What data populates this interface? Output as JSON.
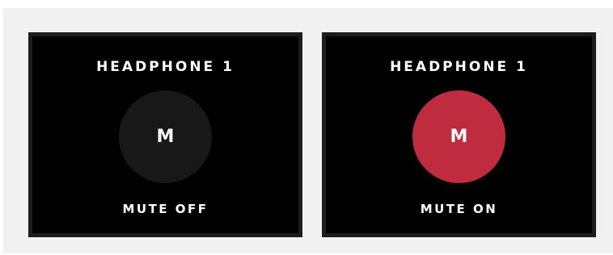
{
  "colors": {
    "panel_background": "#000000",
    "panel_border": "#1c1c1c",
    "page_background": "#f1f1f1",
    "mute_off_button": "#181818",
    "mute_on_button": "#bf2b3f",
    "text": "#ffffff"
  },
  "panels": [
    {
      "title": "HEADPHONE 1",
      "button_label": "M",
      "status": "MUTE OFF",
      "muted": false
    },
    {
      "title": "HEADPHONE 1",
      "button_label": "M",
      "status": "MUTE ON",
      "muted": true
    }
  ]
}
